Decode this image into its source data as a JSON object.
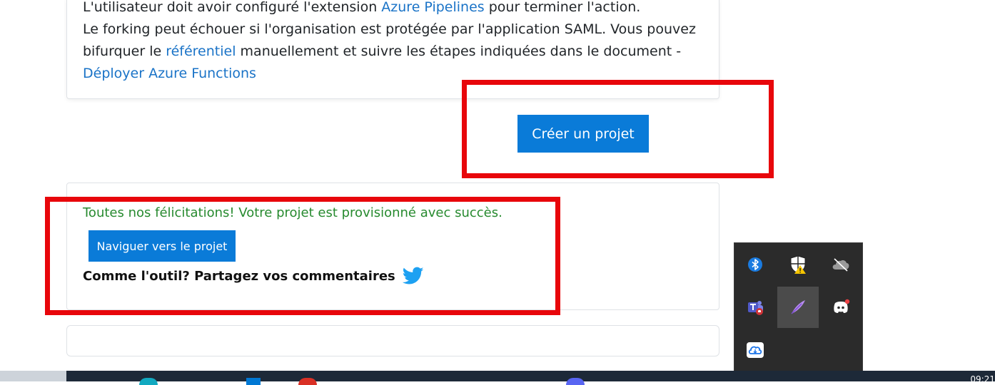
{
  "info": {
    "line1_pre": "L'utilisateur doit avoir configuré l'extension ",
    "line1_link": "Azure Pipelines",
    "line1_post": " pour terminer l'action.",
    "line2": "Le forking peut échouer si l'organisation est protégée par l'application SAML. Vous pouvez",
    "line3_pre": "bifurquer le ",
    "line3_link": "référentiel",
    "line3_post": " manuellement et suivre les étapes indiquées dans le document -",
    "line4_link": "Déployer Azure Functions"
  },
  "create_button": {
    "label": "Créer un projet"
  },
  "success": {
    "message": "Toutes nos félicitations! Votre projet est provisionné avec succès.",
    "nav_button": "Naviguer vers le projet",
    "feedback": "Comme l'outil? Partagez vos commentaires",
    "feedback_icon": "twitter-icon"
  },
  "tray": {
    "icons": [
      "bluetooth-icon",
      "windows-security-warning-icon",
      "onedrive-offline-icon",
      "teams-icon",
      "feather-pen-icon",
      "discord-icon",
      "cloud-sync-icon"
    ]
  },
  "taskbar": {
    "clock": "09:21"
  },
  "colors": {
    "accent": "#0a7bd8",
    "link": "#1a73c7",
    "success": "#278a2f",
    "highlight": "#e8060b",
    "twitter": "#1da1f2"
  }
}
